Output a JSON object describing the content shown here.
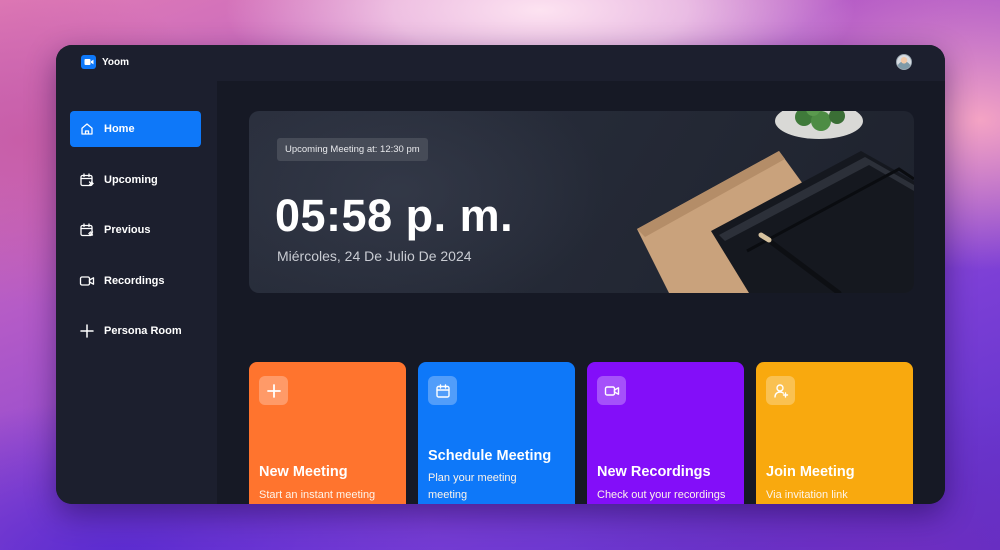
{
  "app": {
    "name": "Yoom",
    "logo_icon": "video-camera-icon"
  },
  "sidebar": {
    "items": [
      {
        "label": "Home",
        "icon": "home-icon",
        "active": true
      },
      {
        "label": "Upcoming",
        "icon": "calendar-upcoming-icon",
        "active": false
      },
      {
        "label": "Previous",
        "icon": "calendar-previous-icon",
        "active": false
      },
      {
        "label": "Recordings",
        "icon": "video-icon",
        "active": false
      },
      {
        "label": "Persona Room",
        "icon": "plus-icon",
        "active": false
      }
    ]
  },
  "hero": {
    "upcoming_label": "Upcoming Meeting at: 12:30 pm",
    "time": "05:58 p. m.",
    "date": "Miércoles, 24 De Julio De 2024"
  },
  "cards": [
    {
      "title": "New Meeting",
      "subtitle": "Start an instant meeting",
      "icon": "plus-icon",
      "color": "#ff742e"
    },
    {
      "title": "Schedule Meeting",
      "subtitle": "Plan your meeting meeting",
      "icon": "calendar-icon",
      "color": "#0e78f9"
    },
    {
      "title": "New Recordings",
      "subtitle": "Check out your recordings",
      "icon": "video-icon",
      "color": "#830ef9"
    },
    {
      "title": "Join Meeting",
      "subtitle": "Via invitation link",
      "icon": "add-user-icon",
      "color": "#f9a90e"
    }
  ],
  "colors": {
    "window_bg": "#1c1f2e",
    "main_bg": "#161925",
    "accent": "#0e78f9"
  }
}
